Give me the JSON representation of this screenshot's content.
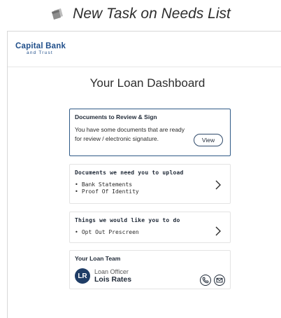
{
  "caption": {
    "text": "New Task on Needs List",
    "icon": "document-icon"
  },
  "header": {
    "logo_line1": "Capital Bank",
    "logo_line2": "and Trust"
  },
  "page": {
    "title": "Your Loan Dashboard"
  },
  "review_card": {
    "title": "Documents to Review & Sign",
    "text": "You have some documents that are ready for review / electronic signature.",
    "button_label": "View"
  },
  "upload_card": {
    "title": "Documents we need you to upload",
    "items": [
      "Bank Statements",
      "Proof Of Identity"
    ]
  },
  "todo_card": {
    "title": "Things we would like you to do",
    "items": [
      "Opt Out Prescreen"
    ]
  },
  "team_card": {
    "title": "Your Loan Team",
    "avatar_initials": "LR",
    "role": "Loan Officer",
    "name": "Lois Rates"
  },
  "colors": {
    "brand": "#1f4e8a",
    "highlight_border": "#2f5a87",
    "avatar_bg": "#1f3d66"
  }
}
